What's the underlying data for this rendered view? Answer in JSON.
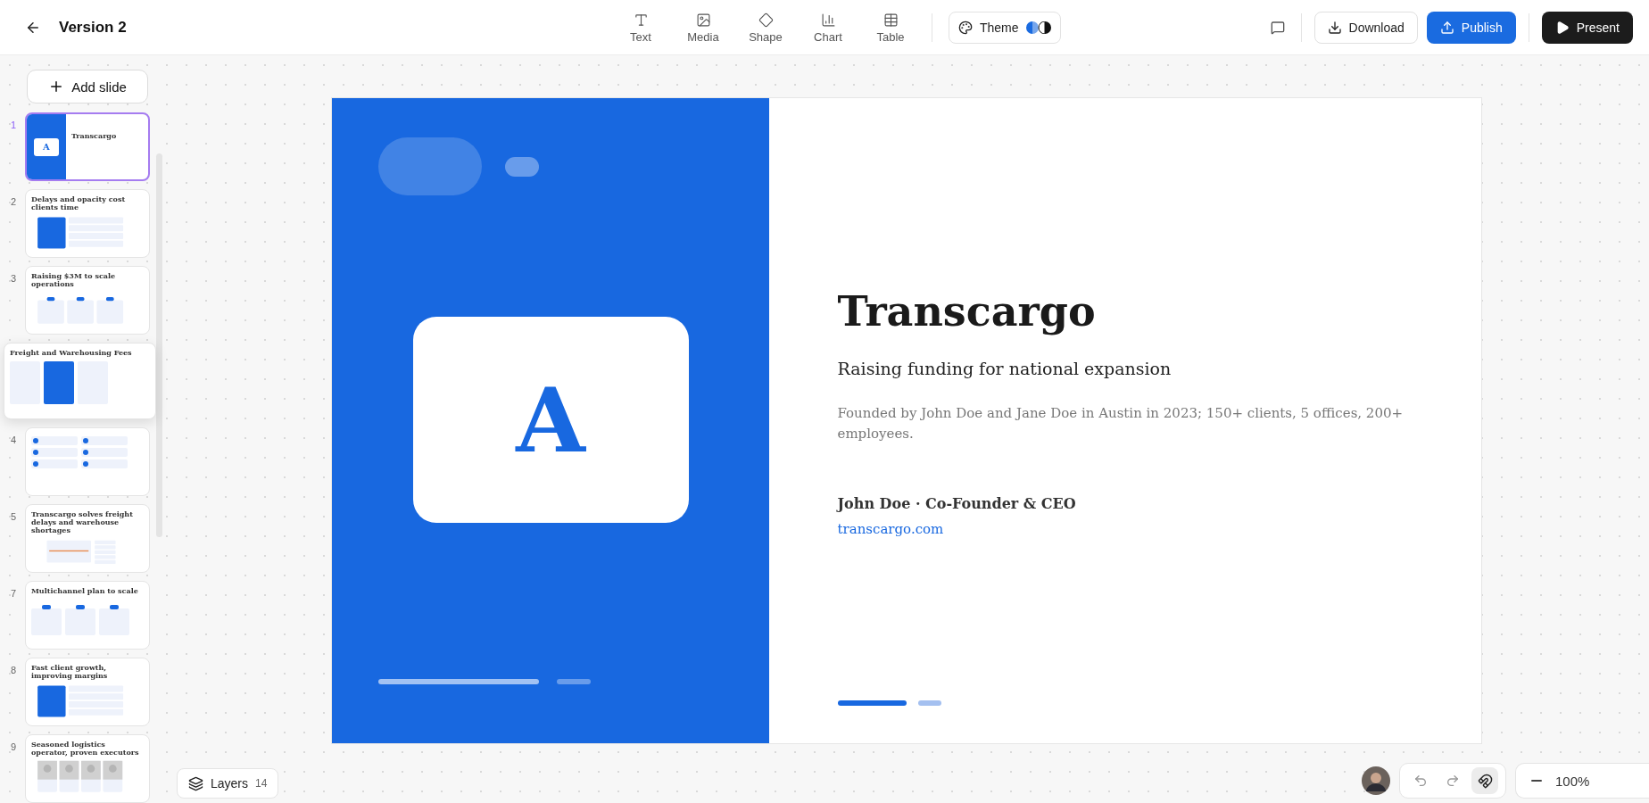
{
  "topbar": {
    "title": "Version 2",
    "tools": [
      {
        "label": "Text",
        "kind": "text"
      },
      {
        "label": "Media",
        "kind": "media"
      },
      {
        "label": "Shape",
        "kind": "shape"
      },
      {
        "label": "Chart",
        "kind": "chart"
      },
      {
        "label": "Table",
        "kind": "table"
      }
    ],
    "theme": {
      "label": "Theme"
    },
    "actions": [
      {
        "label": "Download",
        "kind": "secondary"
      },
      {
        "label": "Publish",
        "kind": "primary"
      },
      {
        "label": "Present",
        "kind": "dark"
      }
    ]
  },
  "sidebar": {
    "add_label": "Add slide",
    "slides": [
      {
        "number": "1",
        "title": "Transcargo",
        "logo_letter": "A",
        "kind": "cover",
        "dragging": false,
        "selected": true
      },
      {
        "number": "2",
        "title": "Delays and opacity cost clients time",
        "kind": "panel",
        "dragging": false,
        "selected": false
      },
      {
        "number": "3",
        "title": "Raising $3M to scale operations",
        "kind": "cards",
        "dragging": false,
        "selected": false
      },
      {
        "title": "Freight and Warehousing Fees",
        "kind": "pricing",
        "dragging": true,
        "selected": false
      },
      {
        "number": "4",
        "kind": "grid",
        "dragging": false,
        "selected": false
      },
      {
        "number": "5",
        "title": "Transcargo solves freight delays and warehouse shortages",
        "kind": "split",
        "dragging": false,
        "selected": false
      },
      {
        "number": "7",
        "title": "Multichannel plan to scale",
        "kind": "cards",
        "dragging": false,
        "selected": false
      },
      {
        "number": "8",
        "title": "Fast client growth, improving margins",
        "kind": "panel",
        "dragging": false,
        "selected": false
      },
      {
        "number": "9",
        "title": "Seasoned logistics operator, proven executors",
        "kind": "people",
        "dragging": false,
        "selected": false
      }
    ]
  },
  "slide": {
    "logo_letter": "A",
    "title": "Transcargo",
    "subtitle": "Raising funding for national expansion",
    "description": "Founded by John Doe and Jane Doe in Austin in 2023; 150+ clients, 5 offices, 200+ employees.",
    "presenter": "John Doe · Co-Founder & CEO",
    "link": "transcargo.com"
  },
  "footer": {
    "layers_label": "Layers",
    "layers_count": "14",
    "zoom": "100%"
  }
}
